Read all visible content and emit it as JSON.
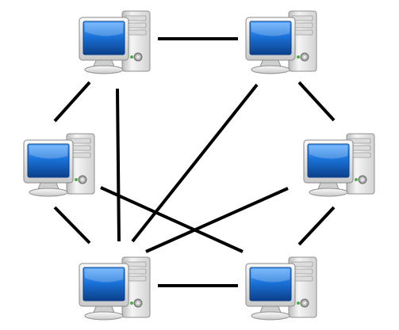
{
  "diagram": {
    "type": "network-topology",
    "nodes": [
      {
        "id": "top-left",
        "icon": "desktop-computer-icon"
      },
      {
        "id": "top-right",
        "icon": "desktop-computer-icon"
      },
      {
        "id": "middle-left",
        "icon": "desktop-computer-icon"
      },
      {
        "id": "middle-right",
        "icon": "desktop-computer-icon"
      },
      {
        "id": "bottom-left",
        "icon": "desktop-computer-icon"
      },
      {
        "id": "bottom-right",
        "icon": "desktop-computer-icon"
      }
    ],
    "edges": [
      {
        "from": "top-left",
        "to": "top-right"
      },
      {
        "from": "top-left",
        "to": "middle-left"
      },
      {
        "from": "top-left",
        "to": "bottom-left"
      },
      {
        "from": "top-right",
        "to": "middle-right"
      },
      {
        "from": "top-right",
        "to": "bottom-left"
      },
      {
        "from": "middle-left",
        "to": "bottom-left"
      },
      {
        "from": "middle-left",
        "to": "bottom-right"
      },
      {
        "from": "middle-right",
        "to": "bottom-left"
      },
      {
        "from": "middle-right",
        "to": "bottom-right"
      },
      {
        "from": "bottom-left",
        "to": "bottom-right"
      }
    ],
    "colors": {
      "edge": "#000000",
      "screen": "#1a73d9",
      "case": "#e6e6e6"
    }
  }
}
